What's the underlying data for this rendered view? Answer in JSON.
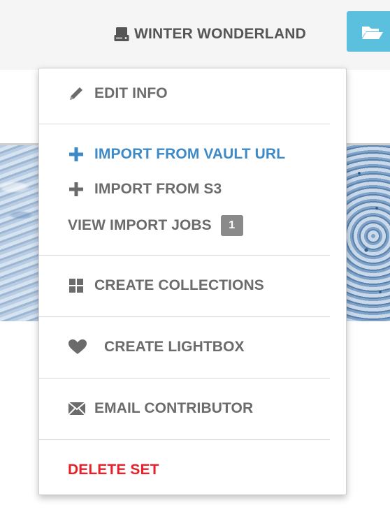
{
  "header": {
    "set_name": "WINTER WONDERLAND"
  },
  "menu": {
    "edit_info": "EDIT INFO",
    "import_vault": "IMPORT FROM VAULT URL",
    "import_s3": "IMPORT FROM S3",
    "view_import_jobs": "VIEW IMPORT JOBS",
    "import_jobs_count": "1",
    "create_collections": "CREATE COLLECTIONS",
    "create_lightbox": "CREATE LIGHTBOX",
    "email_contributor": "EMAIL CONTRIBUTOR",
    "delete_set": "DELETE SET"
  },
  "icons": {
    "set": "hard-drive-icon",
    "folder": "folder-open-icon",
    "edit": "pencil-icon",
    "vault": "plus-icon",
    "s3": "plus-icon",
    "collections": "grid-icon",
    "lightbox": "heart-icon",
    "email": "envelope-icon"
  },
  "colors": {
    "accent_blue": "#3d8ac7",
    "button_blue": "#5bc0de",
    "danger_red": "#e8202a",
    "text_gray": "#6b6b6b"
  }
}
